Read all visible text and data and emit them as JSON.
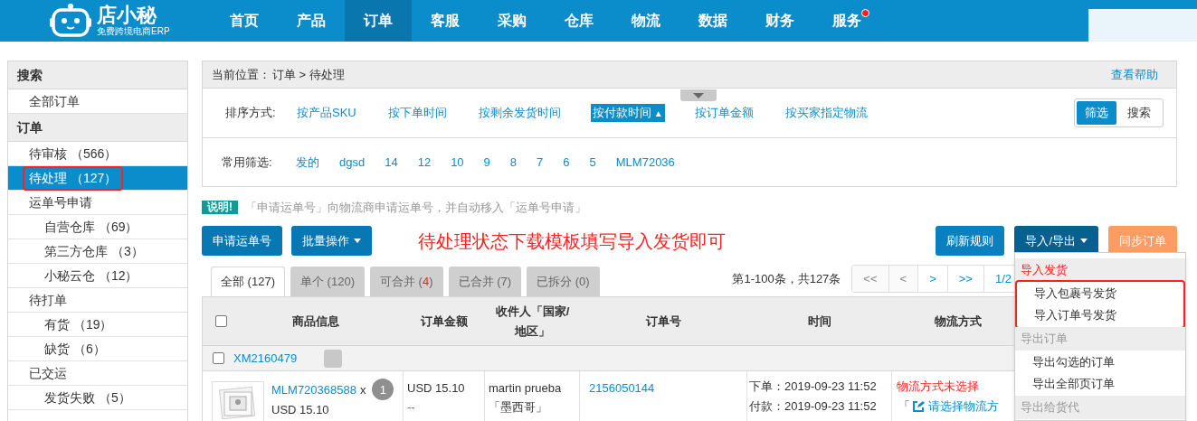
{
  "logo": {
    "name": "店小秘",
    "tagline": "免费跨境电商ERP"
  },
  "nav": [
    {
      "label": "首页",
      "selected": false,
      "badge": false
    },
    {
      "label": "产品",
      "selected": false,
      "badge": false
    },
    {
      "label": "订单",
      "selected": true,
      "badge": false
    },
    {
      "label": "客服",
      "selected": false,
      "badge": false
    },
    {
      "label": "采购",
      "selected": false,
      "badge": false
    },
    {
      "label": "仓库",
      "selected": false,
      "badge": false
    },
    {
      "label": "物流",
      "selected": false,
      "badge": false
    },
    {
      "label": "数据",
      "selected": false,
      "badge": false
    },
    {
      "label": "财务",
      "selected": false,
      "badge": false
    },
    {
      "label": "服务",
      "selected": false,
      "badge": true
    }
  ],
  "sidebar": [
    {
      "title": "搜索",
      "items": [
        {
          "label": "全部订单",
          "selected": false,
          "highlighted": false
        }
      ]
    },
    {
      "title": "订单",
      "items": [
        {
          "label": "待审核 （566）",
          "selected": false,
          "highlighted": false
        },
        {
          "label": "待处理 （127）",
          "selected": true,
          "highlighted": true
        },
        {
          "label": "运单号申请",
          "selected": false,
          "highlighted": false,
          "children": [
            {
              "label": "自营仓库 （69）",
              "selected": false,
              "highlighted": false
            },
            {
              "label": "第三方仓库 （3）",
              "selected": false,
              "highlighted": false
            },
            {
              "label": "小秘云仓 （12）",
              "selected": false,
              "highlighted": false
            }
          ]
        },
        {
          "label": "待打单",
          "selected": false,
          "highlighted": false,
          "children": [
            {
              "label": "有货 （19）",
              "selected": false,
              "highlighted": false
            },
            {
              "label": "缺货 （6）",
              "selected": false,
              "highlighted": false
            }
          ]
        },
        {
          "label": "已交运",
          "selected": false,
          "highlighted": false,
          "children": [
            {
              "label": "发货失败 （5）",
              "selected": false,
              "highlighted": false
            }
          ]
        }
      ]
    }
  ],
  "breadcrumb": {
    "label": "当前位置：",
    "path": "订单 > 待处理",
    "help": "查看帮助"
  },
  "sort": {
    "label": "排序方式:",
    "options": [
      {
        "label": "按产品SKU",
        "selected": false
      },
      {
        "label": "按下单时间",
        "selected": false
      },
      {
        "label": "按剩余发货时间",
        "selected": false
      },
      {
        "label": "按付款时间",
        "selected": true,
        "mark": "▲"
      },
      {
        "label": "按订单金额",
        "selected": false
      },
      {
        "label": "按买家指定物流",
        "selected": false
      }
    ]
  },
  "mode_switch": [
    {
      "label": "筛选",
      "selected": true
    },
    {
      "label": "搜索",
      "selected": false
    }
  ],
  "filters": {
    "label": "常用筛选:",
    "options": [
      "发的",
      "dgsd",
      "14",
      "12",
      "10",
      "9",
      "8",
      "7",
      "6",
      "5",
      "MLM72036"
    ]
  },
  "tip": {
    "badge": "说明!",
    "text": "「申请运单号」向物流商申请运单号，并自动移入「运单号申请」"
  },
  "actions_left": [
    "申请运单号",
    "批量操作"
  ],
  "annotation": "待处理状态下载模板填写导入发货即可",
  "actions_right": [
    {
      "label": "刷新规则",
      "kind": "plain"
    },
    {
      "label": "导入/导出",
      "kind": "dropdown"
    },
    {
      "label": "同步订单",
      "kind": "accent"
    }
  ],
  "tabs": [
    {
      "before": "全部 (",
      "count": "127",
      "after": ")",
      "selected": true,
      "alert": false
    },
    {
      "before": "单个 (",
      "count": "120",
      "after": ")",
      "selected": false,
      "alert": false
    },
    {
      "before": "可合并 (",
      "count": "4",
      "after": ")",
      "selected": false,
      "alert": true
    },
    {
      "before": "已合并 (",
      "count": "7",
      "after": ")",
      "selected": false,
      "alert": false
    },
    {
      "before": "已拆分 (",
      "count": "0",
      "after": ")",
      "selected": false,
      "alert": false
    }
  ],
  "pager": {
    "summary": "第1-100条，共127条",
    "buttons": [
      {
        "label": "<<",
        "disabled": true
      },
      {
        "label": "<",
        "disabled": true
      },
      {
        "label": ">",
        "disabled": false
      },
      {
        "label": ">>",
        "disabled": false
      },
      {
        "label": "1/2",
        "disabled": false
      }
    ]
  },
  "table": {
    "columns": [
      "商品信息",
      "订单金额",
      "收件人「国家/地区」",
      "订单号",
      "时间",
      "物流方式"
    ],
    "select_all": {
      "checked": false
    },
    "group": {
      "id": "XM2160479",
      "checked": false
    },
    "rows": [
      {
        "sku": "MLM720368588",
        "times": "x",
        "qty": "1",
        "price": "USD 15.10",
        "amount": "USD 15.10",
        "amount_note": "--",
        "recipient": "martin prueba",
        "country": "「墨西哥」",
        "order_no": "2156050144",
        "ordered": "下单：2019-09-23 11:52",
        "paid": "付款：2019-09-23 11:52",
        "shipping_status": "物流方式未选择",
        "bracket": "「",
        "shipping_link": "请选择物流方"
      }
    ]
  },
  "menu": [
    {
      "title": "导入发货",
      "highlighted": true,
      "items": [
        "导入包裹号发货",
        "导入订单号发货"
      ]
    },
    {
      "title": "导出订单",
      "highlighted": false,
      "items": [
        "导出勾选的订单",
        "导出全部页订单"
      ]
    },
    {
      "title": "导出给货代",
      "highlighted": false
    }
  ]
}
